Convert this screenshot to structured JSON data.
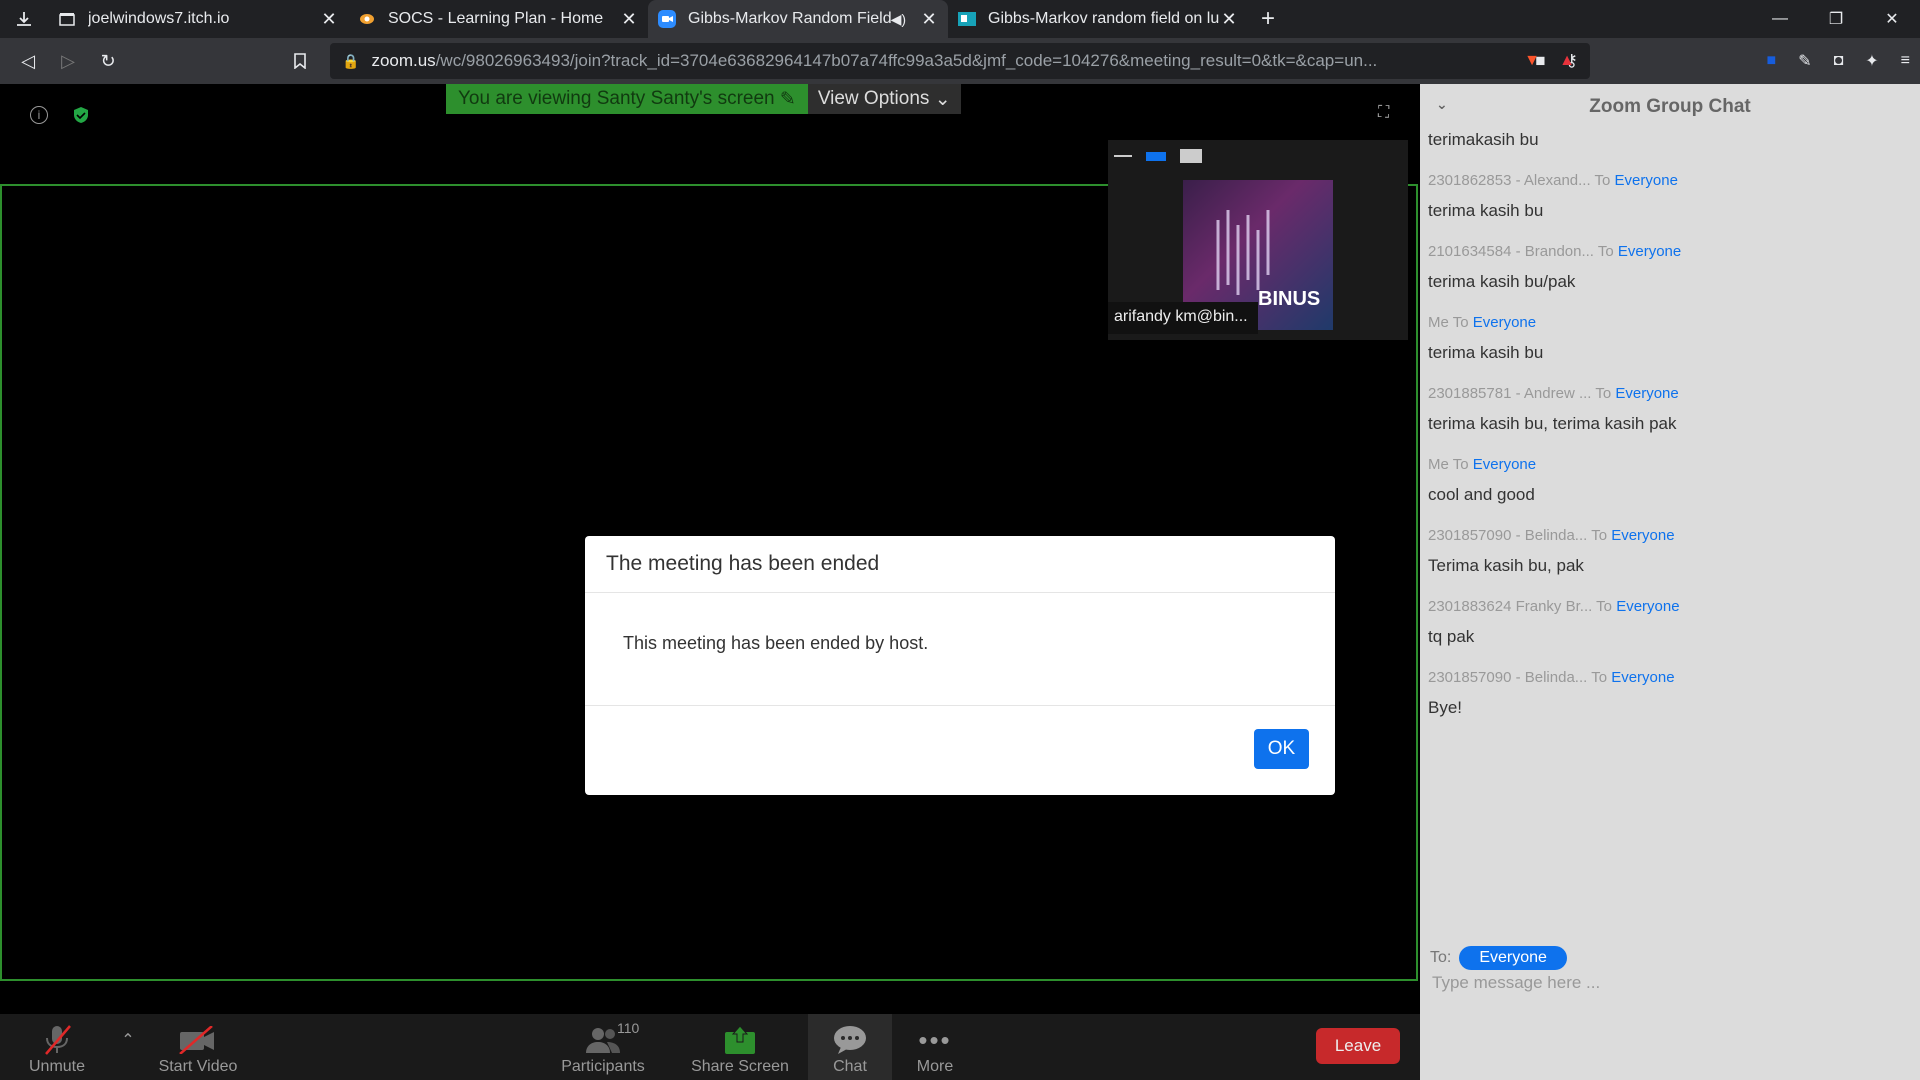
{
  "browser": {
    "tabs": [
      {
        "title": "joelwindows7.itch.io",
        "favicon": "itch-icon"
      },
      {
        "title": "SOCS - Learning Plan - Home",
        "favicon": "socs-icon"
      },
      {
        "title": "Gibbs-Markov Random Field o",
        "favicon": "zoom-icon"
      },
      {
        "title": "Gibbs-Markov random field on lun",
        "favicon": "doc-icon"
      }
    ],
    "url_host": "zoom.us",
    "url_rest": "/wc/98026963493/join?track_id=3704e63682964147b07a74ffc99a3a5d&jmf_code=104276&meeting_result=0&tk=&cap=un..."
  },
  "meeting": {
    "viewing_label": "You are viewing Santy Santy's screen",
    "view_options": "View Options",
    "thumbnail_name": "arifandy km@bin..."
  },
  "modal": {
    "title": "The meeting has been ended",
    "message": "This meeting has been ended by host.",
    "ok_label": "OK"
  },
  "toolbar": {
    "unmute": "Unmute",
    "start_video": "Start Video",
    "participants": "Participants",
    "participants_count": "110",
    "share_screen": "Share Screen",
    "chat": "Chat",
    "more": "More",
    "leave": "Leave"
  },
  "chat": {
    "title": "Zoom Group Chat",
    "first_text": "terimakasih bu",
    "messages": [
      {
        "sender": "2301862853 - Alexand...",
        "to": "Everyone",
        "text": "terima kasih bu"
      },
      {
        "sender": "2101634584 - Brandon...",
        "to": "Everyone",
        "text": "terima kasih bu/pak"
      },
      {
        "sender": "Me",
        "to": "Everyone",
        "text": "terima kasih bu"
      },
      {
        "sender": "2301885781 - Andrew ...",
        "to": "Everyone",
        "text": "terima kasih bu, terima kasih pak"
      },
      {
        "sender": "Me",
        "to": "Everyone",
        "text": "cool and good"
      },
      {
        "sender": "2301857090 - Belinda...",
        "to": "Everyone",
        "text": "Terima kasih bu, pak"
      },
      {
        "sender": "2301883624 Franky Br...",
        "to": "Everyone",
        "text": "tq pak"
      },
      {
        "sender": "2301857090 - Belinda...",
        "to": "Everyone",
        "text": "Bye!"
      }
    ],
    "to_label": "To:",
    "recipient": "Everyone",
    "placeholder": "Type message here ..."
  },
  "colors": {
    "accent": "#0e72ed",
    "share_border": "#2d8f2d",
    "leave": "#c7292b"
  }
}
